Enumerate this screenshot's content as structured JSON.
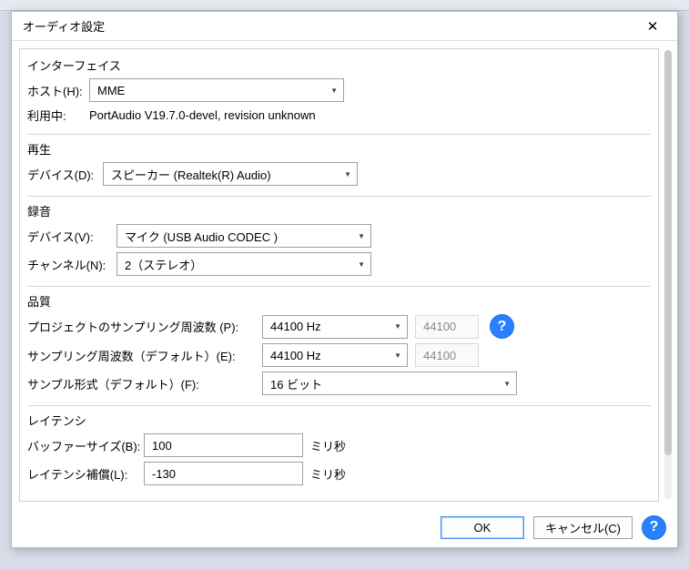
{
  "dialog": {
    "title": "オーディオ設定"
  },
  "sections": {
    "interface": {
      "title": "インターフェイス",
      "host_label": "ホスト(H):",
      "host_value": "MME",
      "using_label": "利用中:",
      "using_value": "PortAudio V19.7.0-devel, revision unknown"
    },
    "playback": {
      "title": "再生",
      "device_label": "デバイス(D):",
      "device_value": "スピーカー (Realtek(R) Audio)"
    },
    "recording": {
      "title": "録音",
      "device_label": "デバイス(V):",
      "device_value": "マイク (USB Audio CODEC )",
      "channels_label": "チャンネル(N):",
      "channels_value": "2（ステレオ）"
    },
    "quality": {
      "title": "品質",
      "project_rate_label": "プロジェクトのサンプリング周波数 (P):",
      "project_rate_value": "44100 Hz",
      "project_rate_readonly": "44100",
      "default_rate_label": "サンプリング周波数（デフォルト）(E):",
      "default_rate_value": "44100 Hz",
      "default_rate_readonly": "44100",
      "format_label": "サンプル形式（デフォルト）(F):",
      "format_value": "16 ビット"
    },
    "latency": {
      "title": "レイテンシ",
      "buffer_label": "バッファーサイズ(B):",
      "buffer_value": "100",
      "buffer_unit": "ミリ秒",
      "compensation_label": "レイテンシ補償(L):",
      "compensation_value": "-130",
      "compensation_unit": "ミリ秒"
    }
  },
  "footer": {
    "ok": "OK",
    "cancel": "キャンセル(C)"
  },
  "help_char": "?"
}
